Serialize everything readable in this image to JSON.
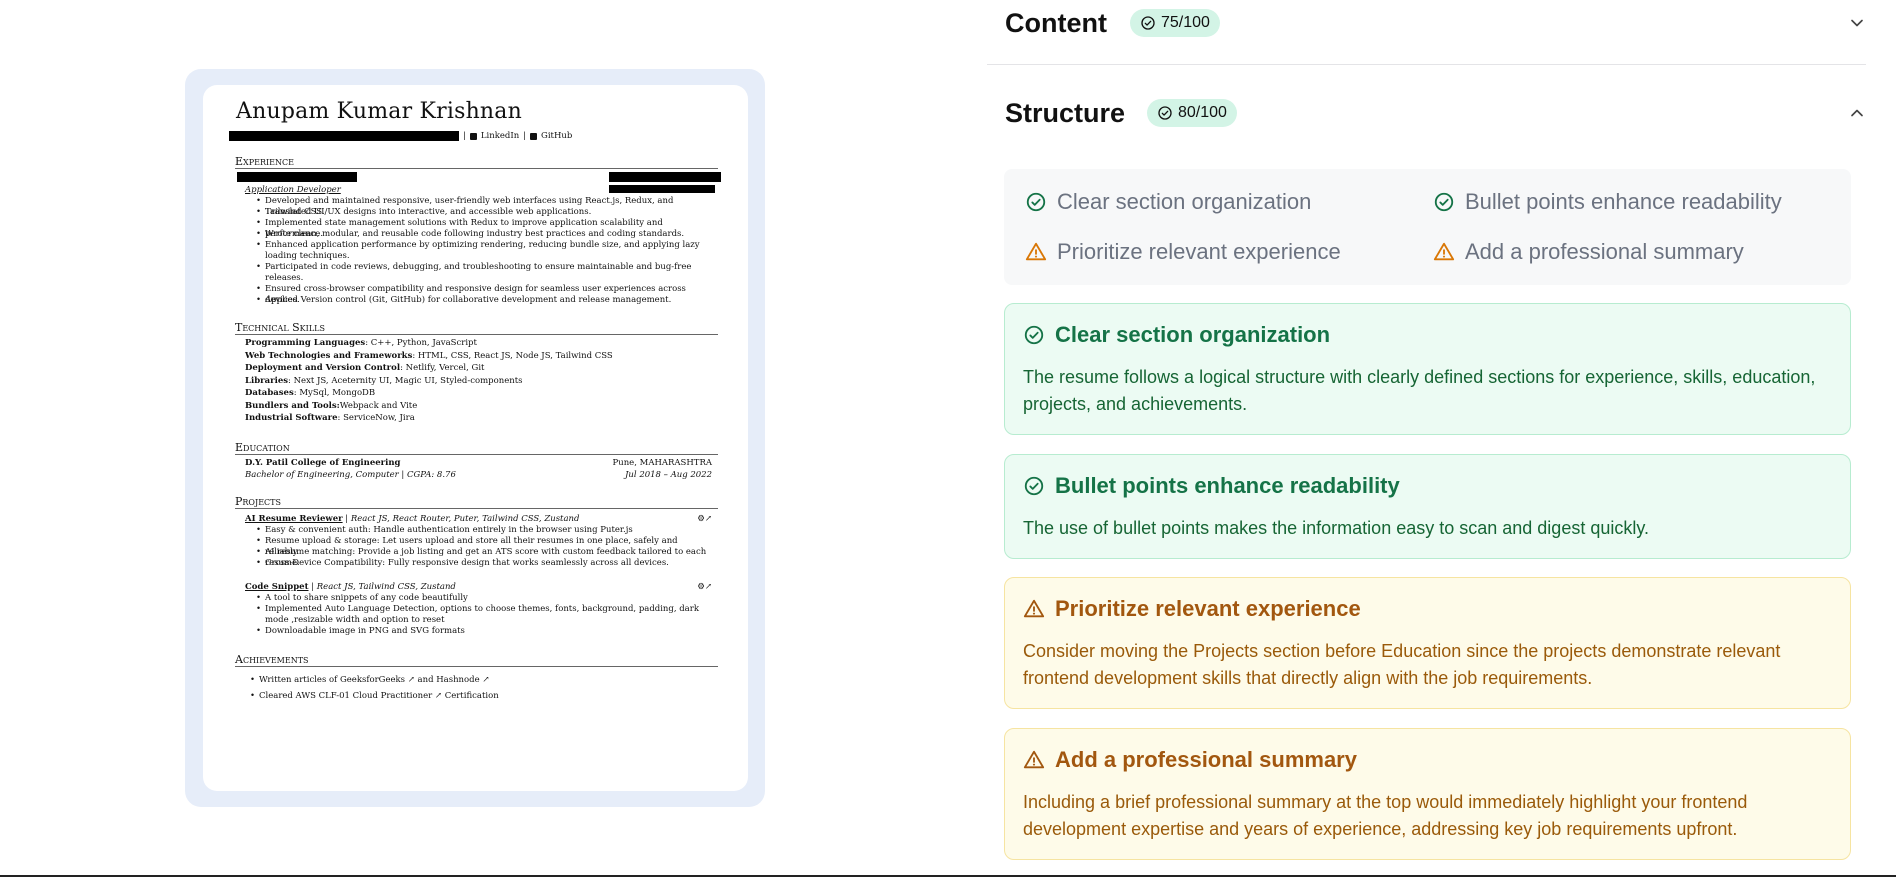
{
  "resume": {
    "name": "Anupam Kumar Krishnan",
    "contact": {
      "linkedin": "LinkedIn",
      "github": "GitHub",
      "separator": "|"
    },
    "sections": {
      "experience": "Experience",
      "skills": "Technical Skills",
      "education": "Education",
      "projects": "Projects",
      "achievements": "Achievements"
    },
    "experience": {
      "role": "Application Developer",
      "bullets": [
        "Developed and maintained responsive, user-friendly web interfaces using React.js, Redux, and Tailwind CSS.",
        "Translated UI/UX designs into interactive, and accessible web applications.",
        "Implemented state management solutions with Redux to improve application scalability and performance.",
        "Wrote clean, modular, and reusable code following industry best practices and coding standards.",
        "Enhanced application performance by optimizing rendering, reducing bundle size, and applying lazy loading techniques.",
        "Participated in code reviews, debugging, and troubleshooting to ensure maintainable and bug-free releases.",
        "Ensured cross-browser compatibility and responsive design for seamless user experiences across devices.",
        "Applied Version control (Git, GitHub) for collaborative development and release management."
      ]
    },
    "skills": [
      {
        "label": "Programming Languages",
        "value": ": C++, Python, JavaScript"
      },
      {
        "label": "Web Technologies and Frameworks",
        "value": ": HTML, CSS, React JS, Node JS, Tailwind CSS"
      },
      {
        "label": "Deployment and Version Control",
        "value": ": Netlify, Vercel, Git"
      },
      {
        "label": "Libraries",
        "value": ": Next JS, Aceternity UI, Magic UI, Styled-components"
      },
      {
        "label": "Databases",
        "value": ": MySql, MongoDB"
      },
      {
        "label": "Bundlers and Tools:",
        "value": "Webpack and Vite"
      },
      {
        "label": "Industrial Software",
        "value": ": ServiceNow, Jira"
      }
    ],
    "education": {
      "school": "D.Y. Patil College of Engineering",
      "location": "Pune, MAHARASHTRA",
      "degree": "Bachelor of Engineering, Computer | CGPA: 8.76",
      "dates": "Jul 2018 – Aug 2022"
    },
    "projects": [
      {
        "name": "AI Resume Reviewer",
        "stack": "| React JS, React Router, Puter, Tailwind CSS, Zustand",
        "bullets": [
          "Easy & convenient auth: Handle authentication entirely in the browser using Puter.js",
          "Resume upload & storage: Let users upload and store all their resumes in one place, safely and reliably.",
          "AI resume matching: Provide a job listing and get an ATS score with custom feedback tailored to each resume.",
          "Cross-Device Compatibility: Fully responsive design that works seamlessly across all devices."
        ]
      },
      {
        "name": "Code Snippet",
        "stack": "| React JS, Tailwind CSS, Zustand",
        "bullets": [
          "A tool to share snippets of any code beautifully",
          "Implemented Auto Language Detection, options to choose themes, fonts, background, padding, dark mode ,resizable width and option to reset",
          "Downloadable image in PNG and SVG formats"
        ]
      }
    ],
    "achievements": [
      "Written articles of GeeksforGeeks ↗ and Hashnode ↗",
      "Cleared AWS CLF-01 Cloud Practitioner ↗ Certification"
    ]
  },
  "feedback": {
    "content": {
      "title": "Content",
      "score": "75/100"
    },
    "structure": {
      "title": "Structure",
      "score": "80/100",
      "summary": [
        {
          "label": "Clear section organization",
          "type": "good",
          "icon": "check-circle-icon"
        },
        {
          "label": "Bullet points enhance readability",
          "type": "good",
          "icon": "check-circle-icon"
        },
        {
          "label": "Prioritize relevant experience",
          "type": "warn",
          "icon": "warning-triangle-icon"
        },
        {
          "label": "Add a professional summary",
          "type": "warn",
          "icon": "warning-triangle-icon"
        }
      ],
      "cards": [
        {
          "title": "Clear section organization",
          "body": "The resume follows a logical structure with clearly defined sections for experience, skills, education, projects, and achievements."
        },
        {
          "title": "Bullet points enhance readability",
          "body": "The use of bullet points makes the information easy to scan and digest quickly."
        },
        {
          "title": "Prioritize relevant experience",
          "body": "Consider moving the Projects section before Education since the projects demonstrate relevant frontend development skills that directly align with the job requirements."
        },
        {
          "title": "Add a professional summary",
          "body": "Including a brief professional summary at the top would immediately highlight your frontend development expertise and years of experience, addressing key job requirements upfront."
        }
      ]
    }
  },
  "colors": {
    "good": "#157347",
    "warn": "#a2570f",
    "badge_bg": "#d3f4e6"
  }
}
